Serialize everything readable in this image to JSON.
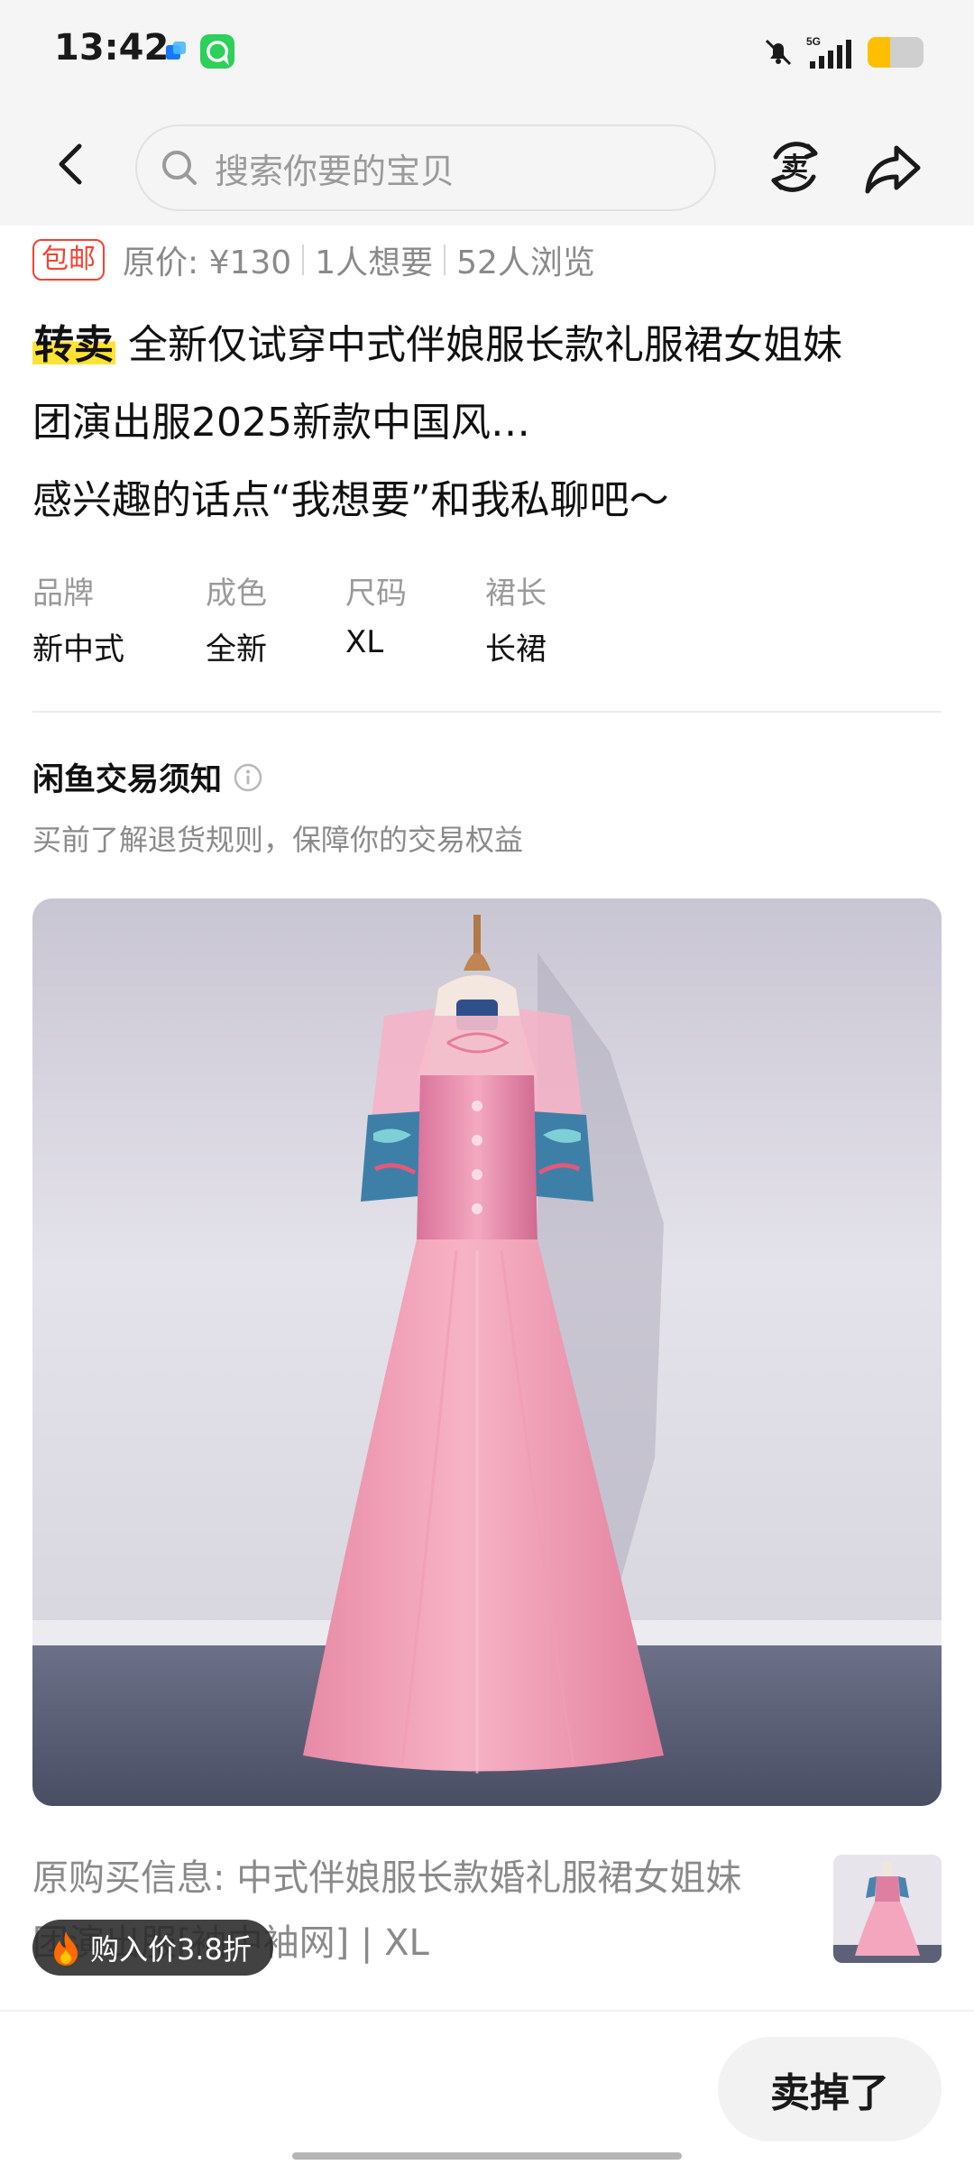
{
  "status_bar": {
    "time": "13:42",
    "network": "5G",
    "battery_level": 0.4
  },
  "header": {
    "search_placeholder": "搜索你要的宝贝",
    "icons": [
      "back-icon",
      "search-icon",
      "sell-icon",
      "share-icon"
    ]
  },
  "listing": {
    "badge": "包邮",
    "original_price": "原价: ¥130",
    "wants": "1人想要",
    "views": "52人浏览",
    "tag": "转卖",
    "title_line1": " 全新仅试穿中式伴娘服长款礼服裙女姐妹",
    "title_line2": "团演出服2025新款中国风…",
    "title_line3": "感兴趣的话点“我想要”和我私聊吧～"
  },
  "attributes": [
    {
      "label": "品牌",
      "value": "新中式"
    },
    {
      "label": "成色",
      "value": "全新"
    },
    {
      "label": "尺码",
      "value": "XL"
    },
    {
      "label": "裙长",
      "value": "长裙"
    }
  ],
  "notice": {
    "title": "闲鱼交易须知",
    "subtitle": "买前了解退货规则，保障你的交易权益"
  },
  "purchase": {
    "line1": "原购买信息: 中式伴娘服长款婚礼服裙女姐妹",
    "line2": "团演出服[袖中袖网] | XL",
    "discount": "购入价3.8折"
  },
  "bottom": {
    "sold_label": "卖掉了"
  },
  "colors": {
    "accent_red": "#ee4433",
    "highlight_yellow": "#ffe333",
    "battery_yellow": "#ffbf00",
    "dress_pink": "#f4a0b8"
  }
}
